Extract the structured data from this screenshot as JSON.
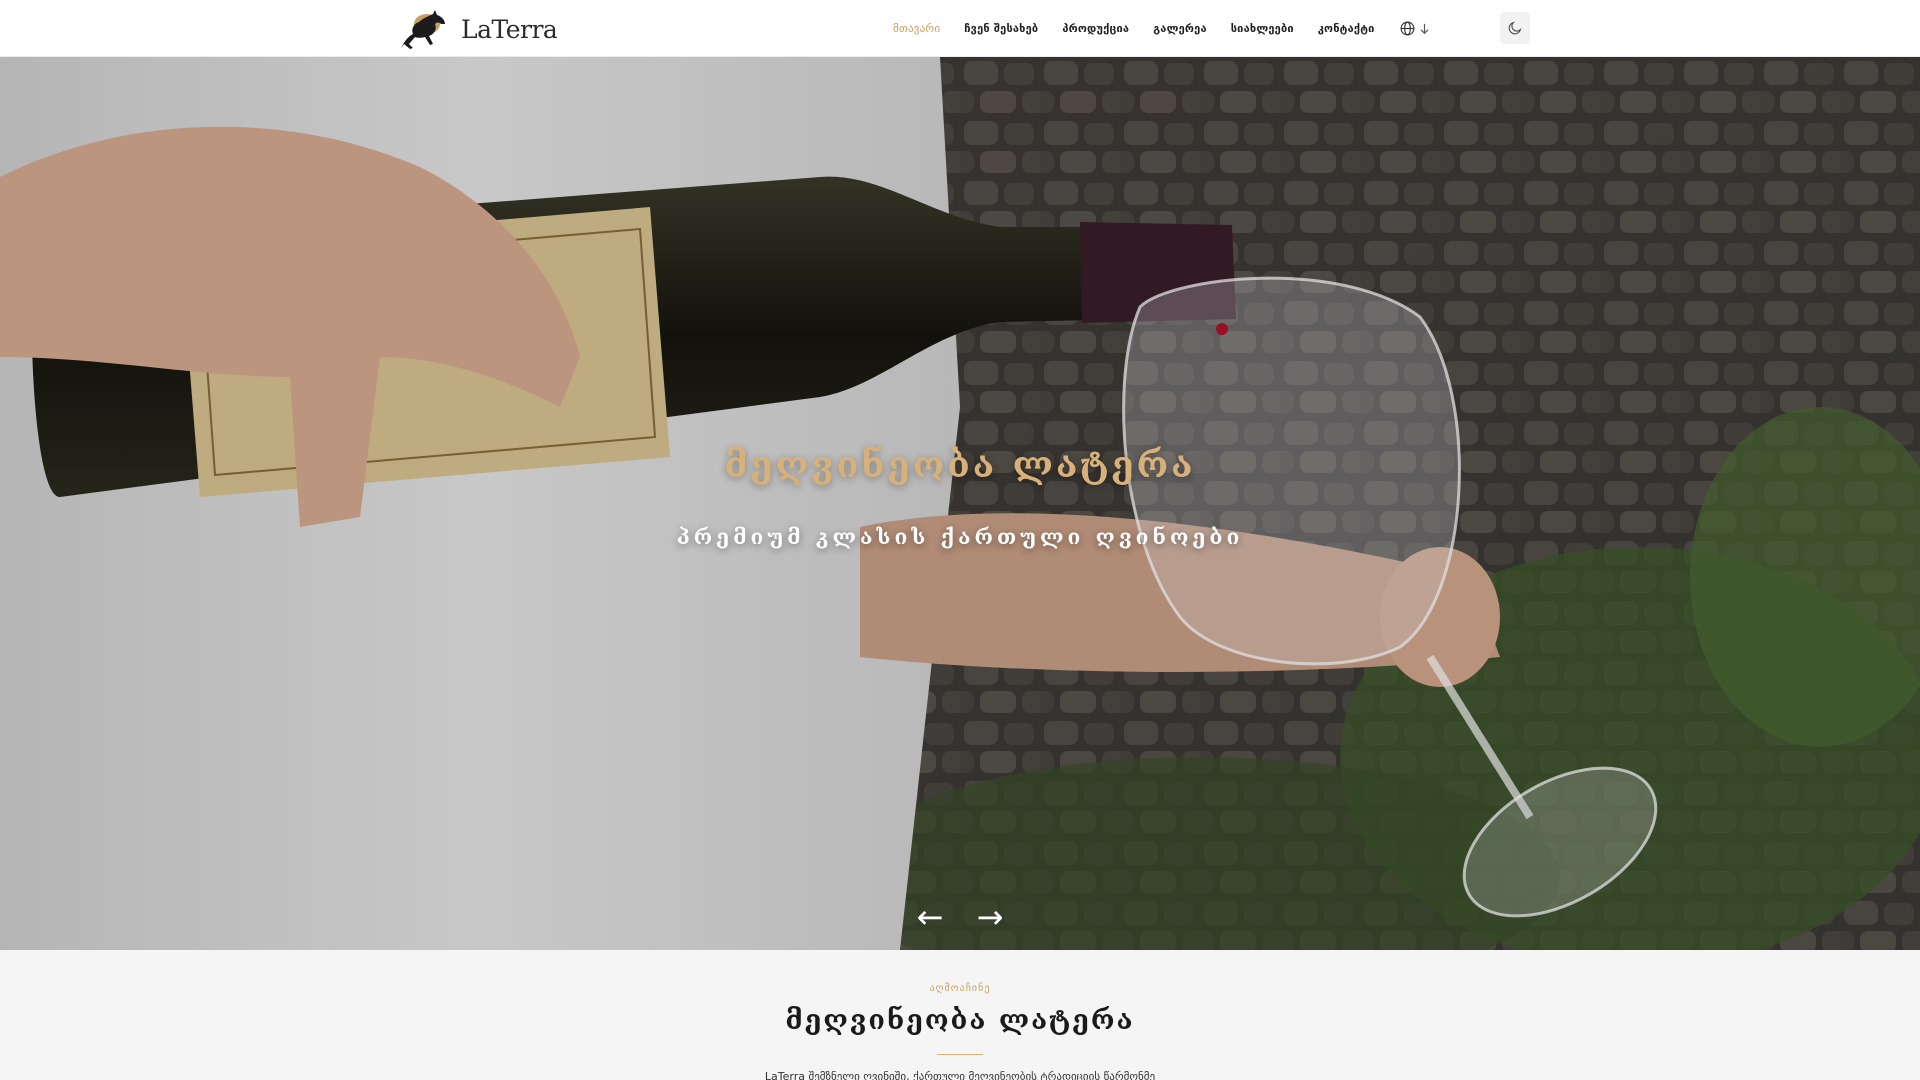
{
  "colors": {
    "accent": "#c9a063",
    "hero_title": "#d7b07a",
    "header_bg": "#ffffff",
    "section_bg": "#f5f5f5"
  },
  "header": {
    "logo_text": "LaTerra",
    "logo_icon": "horse-logo-icon",
    "nav": [
      {
        "label": "მთავარი",
        "active": true
      },
      {
        "label": "ჩვენ შესახებ",
        "active": false
      },
      {
        "label": "პროდუქცია",
        "active": false
      },
      {
        "label": "გალერეა",
        "active": false
      },
      {
        "label": "სიახლეები",
        "active": false
      },
      {
        "label": "კონტაქტი",
        "active": false
      }
    ],
    "language_icon": "globe-icon",
    "theme_icon": "moon-icon"
  },
  "hero": {
    "title": "მეღვინეობა ლატერა",
    "subtitle": "პრემიუმ კლასის ქართული ღვინოები",
    "prev_label": "←",
    "next_label": "→",
    "image": "wine-pouring-photo"
  },
  "about": {
    "kicker": "აღმოაჩინე",
    "title": "მეღვინეობა ლატერა",
    "text": "LaTerra შემზნელი ღვინიში, ქართული მეღვინეობის ტრადიციის წარმონმე"
  }
}
